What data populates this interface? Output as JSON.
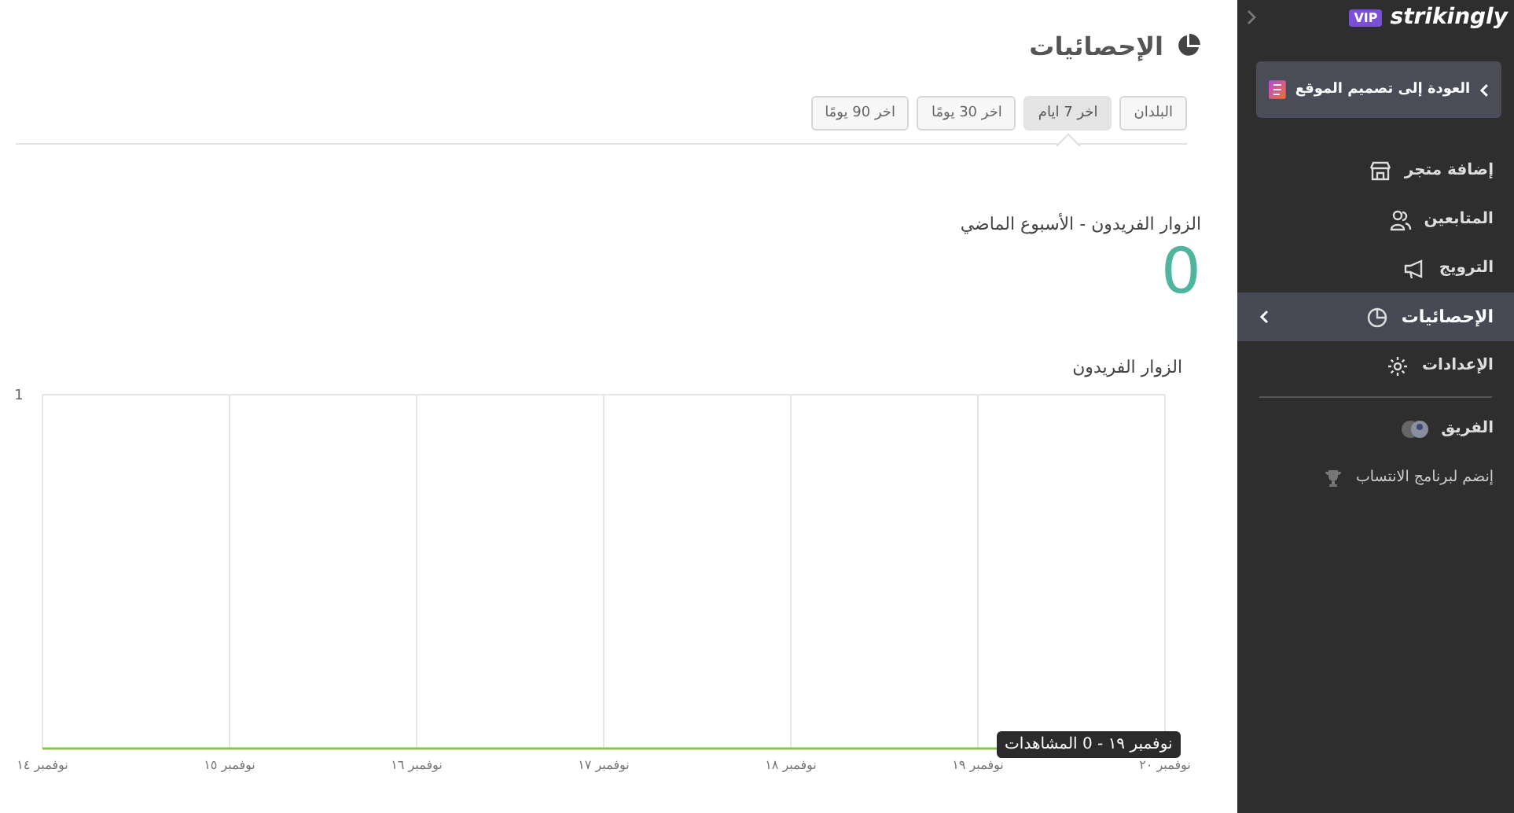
{
  "header": {
    "title": "الإحصائيات"
  },
  "tabs": [
    {
      "label": "البلدان",
      "selected": false
    },
    {
      "label": "اخر 7 ايام",
      "selected": true
    },
    {
      "label": "اخر 30 يومًا",
      "selected": false
    },
    {
      "label": "اخر 90 يومًا",
      "selected": false
    }
  ],
  "summary": {
    "label": "الزوار الفريدون - الأسبوع الماضي",
    "value": "0"
  },
  "chart": {
    "title": "الزوار الفريدون",
    "tooltip": "نوفمبر ١٩ - 0 المشاهدات",
    "y_label": "1",
    "x_labels": [
      "نوفمبر ٢٠",
      "نوفمبر ١٩",
      "نوفمبر ١٨",
      "نوفمبر ١٧",
      "نوفمبر ١٦",
      "نوفمبر ١٥",
      "نوفمبر ١٤"
    ]
  },
  "sidebar": {
    "badge": "VIP",
    "brand": "strikingly",
    "back_button": "العودة إلى تصميم الموقع",
    "items": [
      {
        "label": "إضافة متجر",
        "selected": false
      },
      {
        "label": "المتابعين",
        "selected": false
      },
      {
        "label": "الترويج",
        "selected": false
      },
      {
        "label": "الإحصائيات",
        "selected": true
      },
      {
        "label": "الإعدادات",
        "selected": false
      }
    ],
    "extras": [
      {
        "label": "الفريق"
      },
      {
        "label": "إنضم لبرنامج الانتساب"
      }
    ]
  }
}
